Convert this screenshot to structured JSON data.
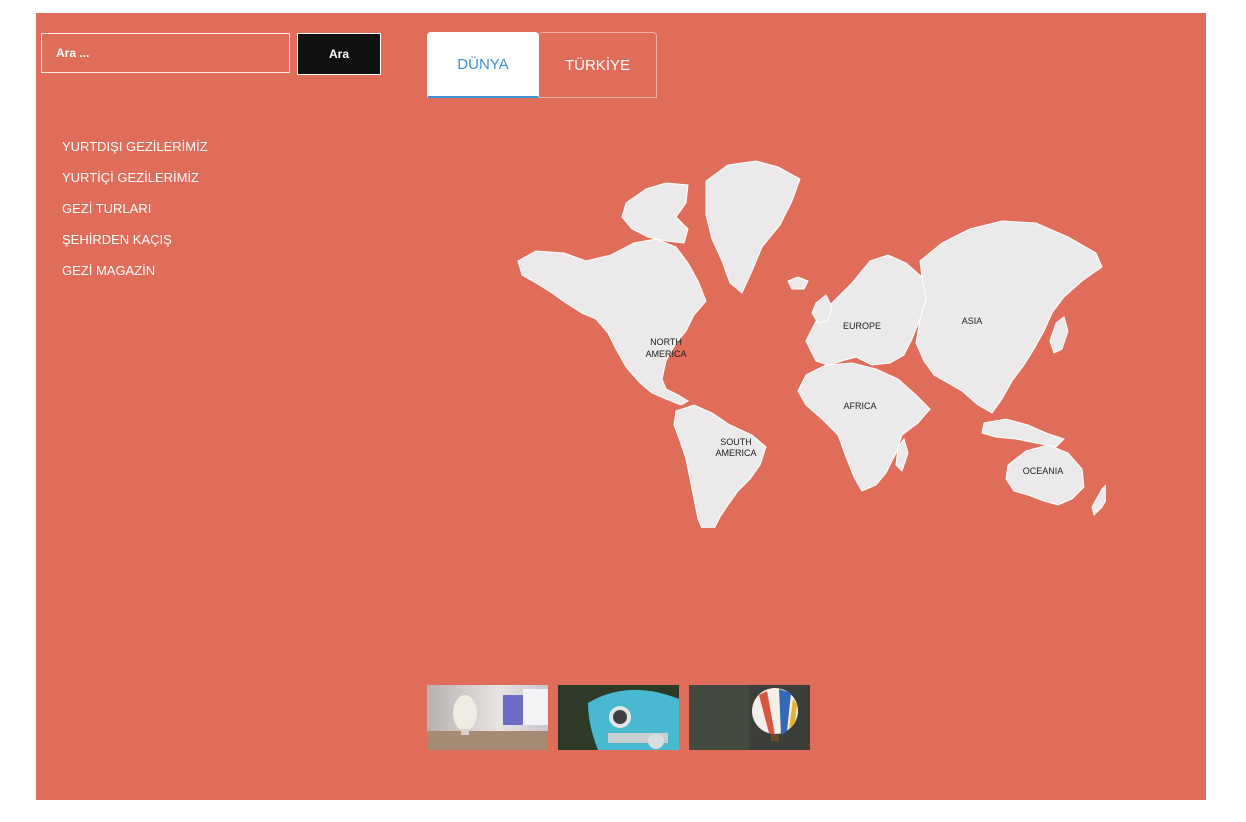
{
  "search": {
    "placeholder": "Ara ...",
    "button_label": "Ara"
  },
  "tabs": [
    {
      "label": "DÜNYA",
      "active": true
    },
    {
      "label": "TÜRKİYE",
      "active": false
    }
  ],
  "nav": {
    "items": [
      {
        "label": "YURTDIŞI GEZİLERİMİZ"
      },
      {
        "label": "YURTİÇİ GEZİLERİMİZ"
      },
      {
        "label": "GEZİ TURLARI"
      },
      {
        "label": "ŞEHİRDEN KAÇIŞ"
      },
      {
        "label": "GEZİ MAGAZİN"
      }
    ]
  },
  "map": {
    "regions": {
      "north_america": [
        "NORTH",
        "AMERICA"
      ],
      "south_america": [
        "SOUTH",
        "AMERICA"
      ],
      "europe": "EUROPE",
      "africa": "AFRICA",
      "asia": "ASIA",
      "oceania": "OCEANIA"
    }
  },
  "thumbnails": [
    {
      "icon": "vase-photo"
    },
    {
      "icon": "blue-car-photo"
    },
    {
      "icon": "hot-air-balloon-photo"
    }
  ],
  "colors": {
    "background": "#e06c5a",
    "active_tab_text": "#3b8fd8",
    "search_button": "#111111",
    "land": "#ece9ea"
  }
}
